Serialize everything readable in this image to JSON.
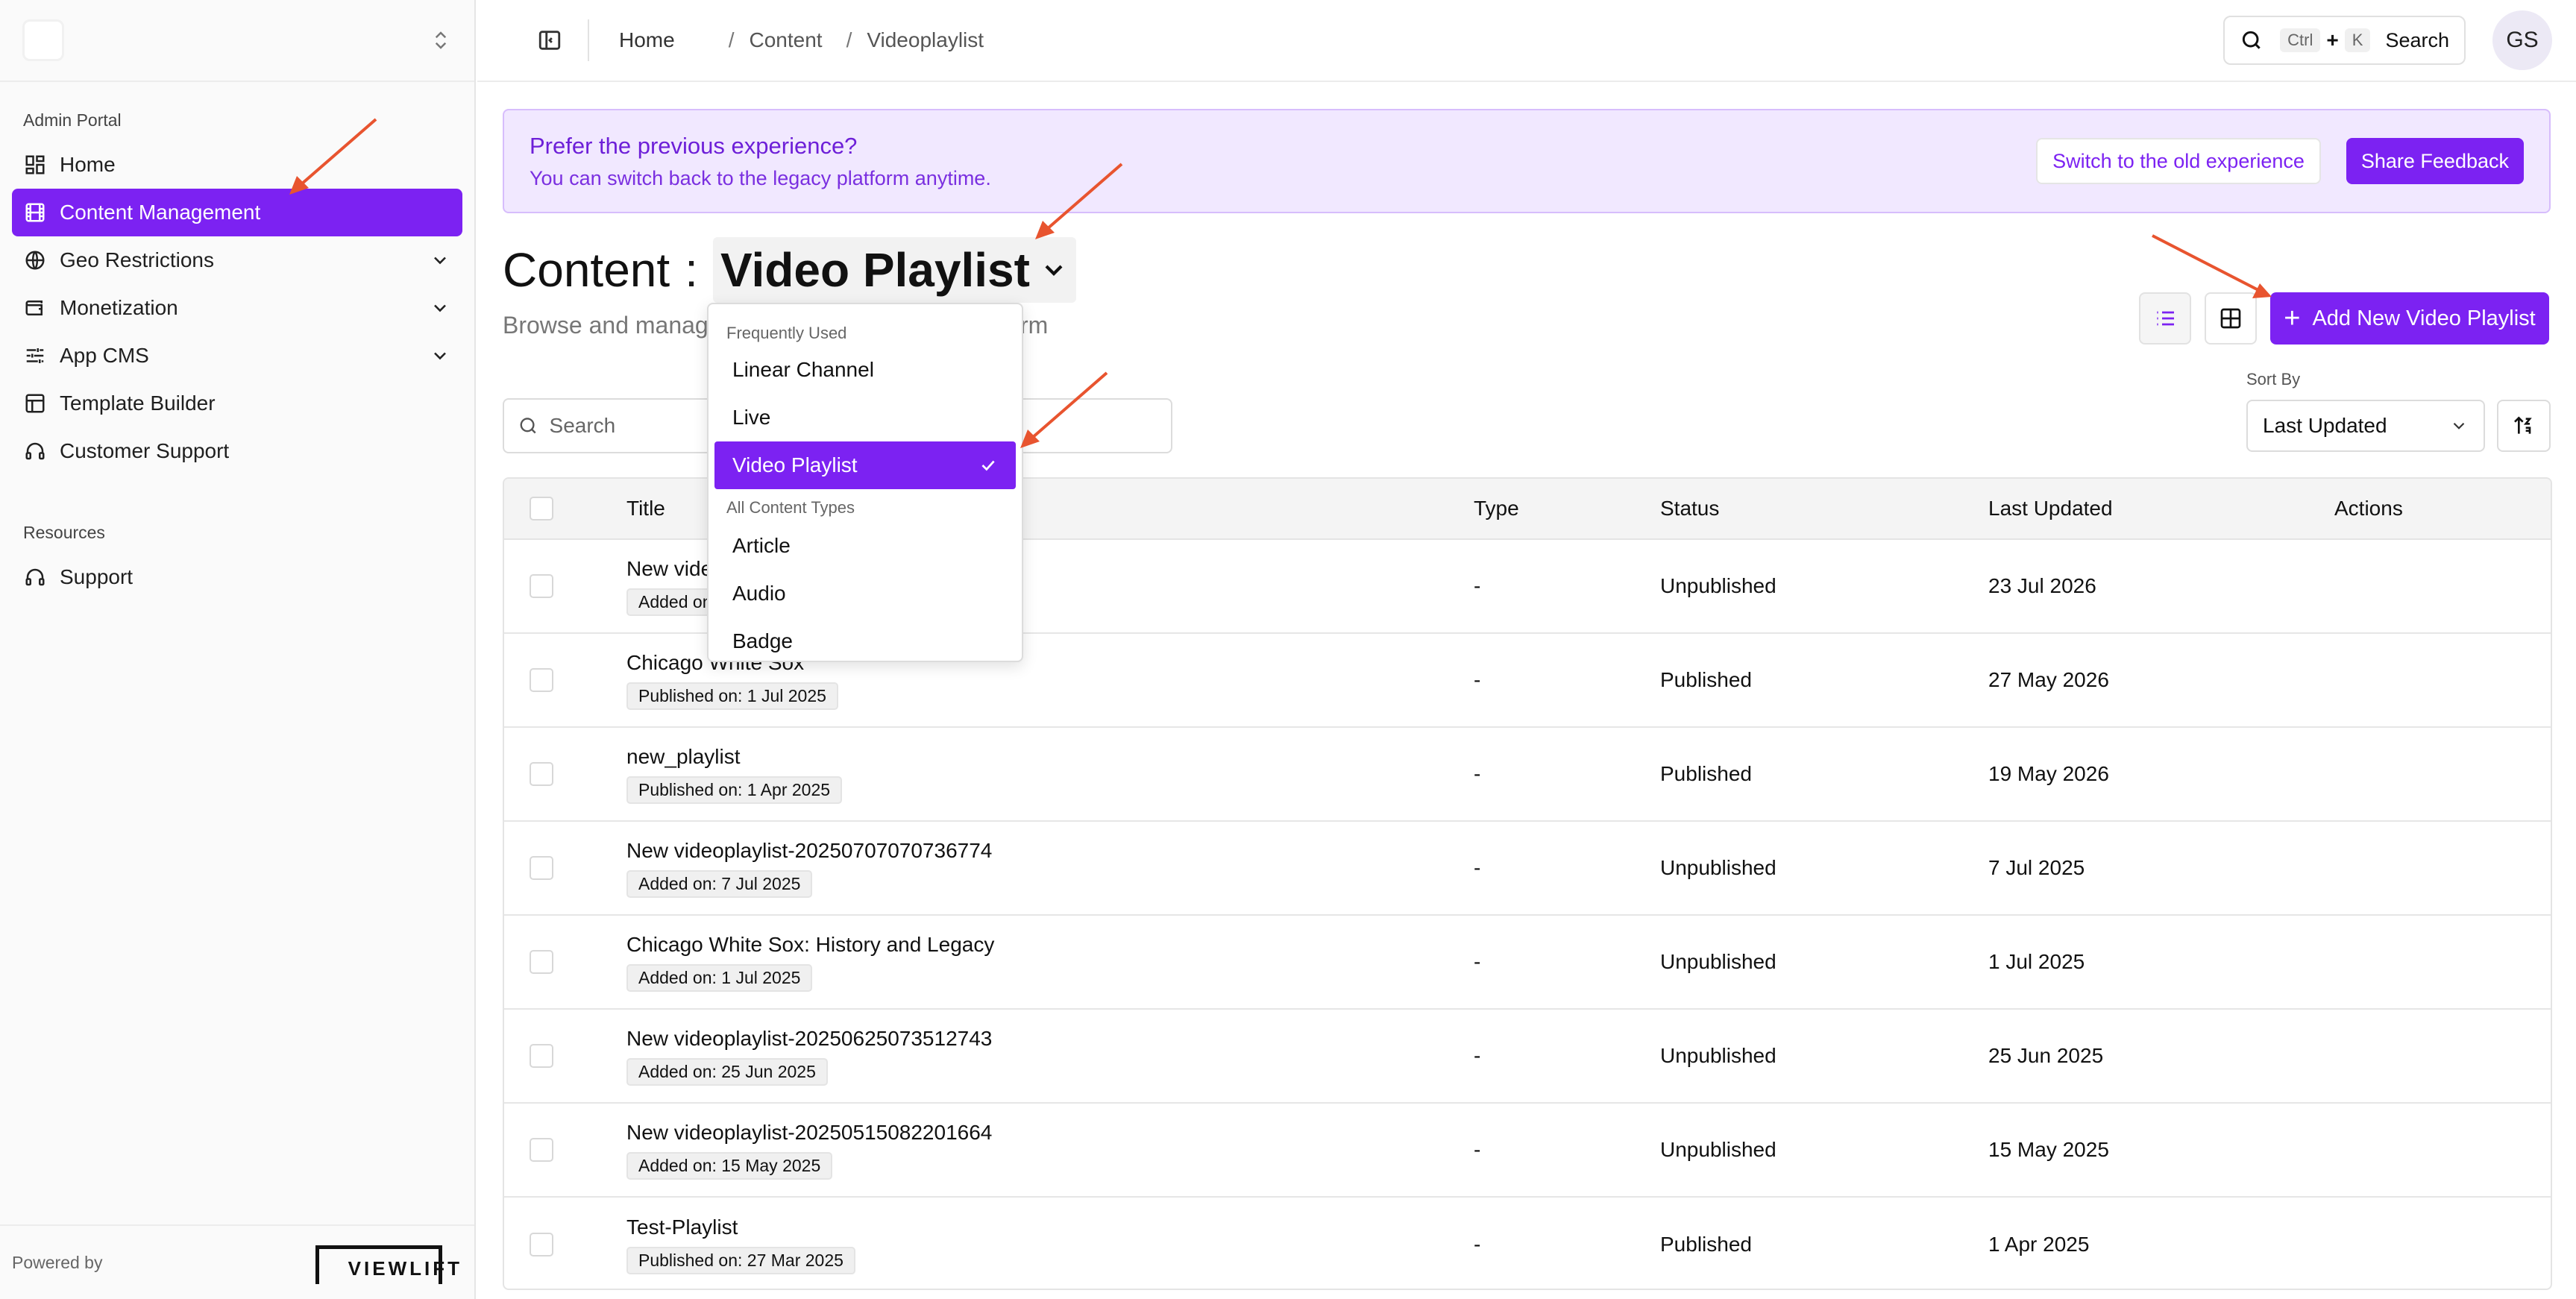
{
  "sidebar": {
    "portal_label": "Admin Portal",
    "items": [
      {
        "label": "Home",
        "icon": "dashboard-icon",
        "active": false
      },
      {
        "label": "Content Management",
        "icon": "film-icon",
        "active": true
      },
      {
        "label": "Geo Restrictions",
        "icon": "globe-icon",
        "expandable": true
      },
      {
        "label": "Monetization",
        "icon": "wallet-icon",
        "expandable": true
      },
      {
        "label": "App CMS",
        "icon": "sliders-icon",
        "expandable": true
      },
      {
        "label": "Template Builder",
        "icon": "layout-icon"
      },
      {
        "label": "Customer Support",
        "icon": "headset-icon"
      }
    ],
    "resources_label": "Resources",
    "resources": [
      {
        "label": "Support",
        "icon": "headset-icon"
      }
    ],
    "powered_by": "Powered by",
    "brand_logo_text": "VIEWLIFT"
  },
  "topbar": {
    "breadcrumb": [
      "Home",
      "Content",
      "Videoplaylist"
    ],
    "search": {
      "kbd1": "Ctrl",
      "plus": "+",
      "kbd2": "K",
      "label": "Search"
    },
    "avatar_initials": "GS"
  },
  "banner": {
    "title": "Prefer the previous experience?",
    "subtitle": "You can switch back to the legacy platform anytime.",
    "switch_label": "Switch to the old experience",
    "feedback_label": "Share Feedback"
  },
  "page": {
    "heading": "Content",
    "colon": ":",
    "selected_type": "Video Playlist",
    "subtitle_start": "Browse and manag",
    "subtitle_end": "rm",
    "add_button": "Add New Video Playlist",
    "sort_label": "Sort By",
    "sort_value": "Last Updated",
    "search_placeholder": "Search"
  },
  "dropdown": {
    "group1": "Frequently Used",
    "items1": [
      "Linear Channel",
      "Live",
      "Video Playlist"
    ],
    "group2": "All Content Types",
    "items2": [
      "Article",
      "Audio",
      "Badge"
    ]
  },
  "table": {
    "headers": {
      "title": "Title",
      "type": "Type",
      "status": "Status",
      "updated": "Last Updated",
      "actions": "Actions"
    },
    "rows": [
      {
        "title": "New vide",
        "tag": "Added on",
        "type": "-",
        "status": "Unpublished",
        "updated": "23 Jul 2026"
      },
      {
        "title": "Chicago White Sox",
        "tag": "Published on: 1 Jul 2025",
        "type": "-",
        "status": "Published",
        "updated": "27 May 2026"
      },
      {
        "title": "new_playlist",
        "tag": "Published on: 1 Apr 2025",
        "type": "-",
        "status": "Published",
        "updated": "19 May 2026"
      },
      {
        "title": "New videoplaylist-20250707070736774",
        "tag": "Added on: 7 Jul 2025",
        "type": "-",
        "status": "Unpublished",
        "updated": "7 Jul 2025"
      },
      {
        "title": "Chicago White Sox: History and Legacy",
        "tag": "Added on: 1 Jul 2025",
        "type": "-",
        "status": "Unpublished",
        "updated": "1 Jul 2025"
      },
      {
        "title": "New videoplaylist-20250625073512743",
        "tag": "Added on: 25 Jun 2025",
        "type": "-",
        "status": "Unpublished",
        "updated": "25 Jun 2025"
      },
      {
        "title": "New videoplaylist-20250515082201664",
        "tag": "Added on: 15 May 2025",
        "type": "-",
        "status": "Unpublished",
        "updated": "15 May 2025"
      },
      {
        "title": "Test-Playlist",
        "tag": "Published on: 27 Mar 2025",
        "type": "-",
        "status": "Published",
        "updated": "1 Apr 2025"
      }
    ]
  },
  "colors": {
    "accent": "#7c22f2",
    "banner_bg": "#f1e8ff",
    "annotation_arrow": "#e8542f"
  }
}
